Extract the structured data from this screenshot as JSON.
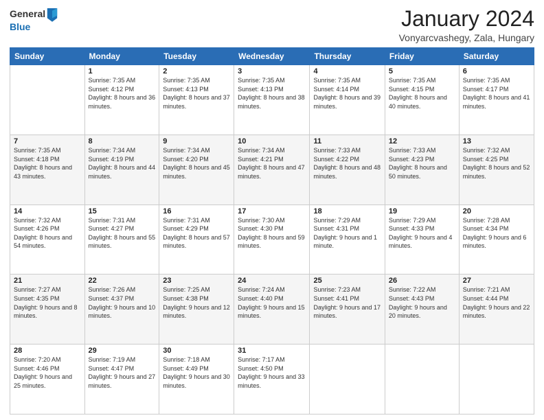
{
  "header": {
    "logo_general": "General",
    "logo_blue": "Blue",
    "title": "January 2024",
    "subtitle": "Vonyarcvashegy, Zala, Hungary"
  },
  "days_of_week": [
    "Sunday",
    "Monday",
    "Tuesday",
    "Wednesday",
    "Thursday",
    "Friday",
    "Saturday"
  ],
  "weeks": [
    [
      {
        "day": "",
        "sunrise": "",
        "sunset": "",
        "daylight": ""
      },
      {
        "day": "1",
        "sunrise": "7:35 AM",
        "sunset": "4:12 PM",
        "daylight": "8 hours and 36 minutes."
      },
      {
        "day": "2",
        "sunrise": "7:35 AM",
        "sunset": "4:13 PM",
        "daylight": "8 hours and 37 minutes."
      },
      {
        "day": "3",
        "sunrise": "7:35 AM",
        "sunset": "4:13 PM",
        "daylight": "8 hours and 38 minutes."
      },
      {
        "day": "4",
        "sunrise": "7:35 AM",
        "sunset": "4:14 PM",
        "daylight": "8 hours and 39 minutes."
      },
      {
        "day": "5",
        "sunrise": "7:35 AM",
        "sunset": "4:15 PM",
        "daylight": "8 hours and 40 minutes."
      },
      {
        "day": "6",
        "sunrise": "7:35 AM",
        "sunset": "4:17 PM",
        "daylight": "8 hours and 41 minutes."
      }
    ],
    [
      {
        "day": "7",
        "sunrise": "7:35 AM",
        "sunset": "4:18 PM",
        "daylight": "8 hours and 43 minutes."
      },
      {
        "day": "8",
        "sunrise": "7:34 AM",
        "sunset": "4:19 PM",
        "daylight": "8 hours and 44 minutes."
      },
      {
        "day": "9",
        "sunrise": "7:34 AM",
        "sunset": "4:20 PM",
        "daylight": "8 hours and 45 minutes."
      },
      {
        "day": "10",
        "sunrise": "7:34 AM",
        "sunset": "4:21 PM",
        "daylight": "8 hours and 47 minutes."
      },
      {
        "day": "11",
        "sunrise": "7:33 AM",
        "sunset": "4:22 PM",
        "daylight": "8 hours and 48 minutes."
      },
      {
        "day": "12",
        "sunrise": "7:33 AM",
        "sunset": "4:23 PM",
        "daylight": "8 hours and 50 minutes."
      },
      {
        "day": "13",
        "sunrise": "7:32 AM",
        "sunset": "4:25 PM",
        "daylight": "8 hours and 52 minutes."
      }
    ],
    [
      {
        "day": "14",
        "sunrise": "7:32 AM",
        "sunset": "4:26 PM",
        "daylight": "8 hours and 54 minutes."
      },
      {
        "day": "15",
        "sunrise": "7:31 AM",
        "sunset": "4:27 PM",
        "daylight": "8 hours and 55 minutes."
      },
      {
        "day": "16",
        "sunrise": "7:31 AM",
        "sunset": "4:29 PM",
        "daylight": "8 hours and 57 minutes."
      },
      {
        "day": "17",
        "sunrise": "7:30 AM",
        "sunset": "4:30 PM",
        "daylight": "8 hours and 59 minutes."
      },
      {
        "day": "18",
        "sunrise": "7:29 AM",
        "sunset": "4:31 PM",
        "daylight": "9 hours and 1 minute."
      },
      {
        "day": "19",
        "sunrise": "7:29 AM",
        "sunset": "4:33 PM",
        "daylight": "9 hours and 4 minutes."
      },
      {
        "day": "20",
        "sunrise": "7:28 AM",
        "sunset": "4:34 PM",
        "daylight": "9 hours and 6 minutes."
      }
    ],
    [
      {
        "day": "21",
        "sunrise": "7:27 AM",
        "sunset": "4:35 PM",
        "daylight": "9 hours and 8 minutes."
      },
      {
        "day": "22",
        "sunrise": "7:26 AM",
        "sunset": "4:37 PM",
        "daylight": "9 hours and 10 minutes."
      },
      {
        "day": "23",
        "sunrise": "7:25 AM",
        "sunset": "4:38 PM",
        "daylight": "9 hours and 12 minutes."
      },
      {
        "day": "24",
        "sunrise": "7:24 AM",
        "sunset": "4:40 PM",
        "daylight": "9 hours and 15 minutes."
      },
      {
        "day": "25",
        "sunrise": "7:23 AM",
        "sunset": "4:41 PM",
        "daylight": "9 hours and 17 minutes."
      },
      {
        "day": "26",
        "sunrise": "7:22 AM",
        "sunset": "4:43 PM",
        "daylight": "9 hours and 20 minutes."
      },
      {
        "day": "27",
        "sunrise": "7:21 AM",
        "sunset": "4:44 PM",
        "daylight": "9 hours and 22 minutes."
      }
    ],
    [
      {
        "day": "28",
        "sunrise": "7:20 AM",
        "sunset": "4:46 PM",
        "daylight": "9 hours and 25 minutes."
      },
      {
        "day": "29",
        "sunrise": "7:19 AM",
        "sunset": "4:47 PM",
        "daylight": "9 hours and 27 minutes."
      },
      {
        "day": "30",
        "sunrise": "7:18 AM",
        "sunset": "4:49 PM",
        "daylight": "9 hours and 30 minutes."
      },
      {
        "day": "31",
        "sunrise": "7:17 AM",
        "sunset": "4:50 PM",
        "daylight": "9 hours and 33 minutes."
      },
      {
        "day": "",
        "sunrise": "",
        "sunset": "",
        "daylight": ""
      },
      {
        "day": "",
        "sunrise": "",
        "sunset": "",
        "daylight": ""
      },
      {
        "day": "",
        "sunrise": "",
        "sunset": "",
        "daylight": ""
      }
    ]
  ]
}
